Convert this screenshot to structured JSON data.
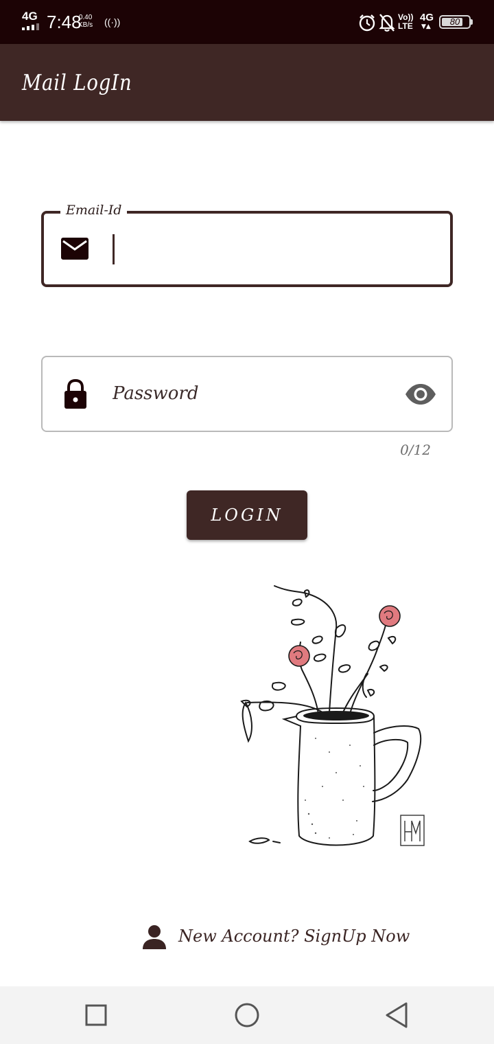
{
  "status_bar": {
    "network": "4G",
    "time": "7:48",
    "speed_value": "0.40",
    "speed_unit": "KB/s",
    "hotspot_icon": "hotspot-icon",
    "volte_line1": "Vo))",
    "volte_line2": "LTE",
    "network_type": "4G",
    "battery": "80",
    "battery_level": 0.8
  },
  "app_bar": {
    "title": "Mail LogIn"
  },
  "email_field": {
    "label": "Email-Id",
    "value": "",
    "icon": "mail-icon"
  },
  "password_field": {
    "placeholder": "Password",
    "value": "",
    "icon": "lock-icon",
    "toggle_icon": "eye-icon",
    "counter": "0/12"
  },
  "login_button": {
    "label": "LOGIN"
  },
  "illustration": {
    "monogram": "HM",
    "description_icon": "flower-vase-illustration"
  },
  "signup": {
    "icon": "person-icon",
    "label": "New Account?  SignUp Now"
  },
  "nav_bar": {
    "recents_icon": "square-icon",
    "home_icon": "circle-icon",
    "back_icon": "triangle-back-icon"
  },
  "colors": {
    "status_bar_bg": "#1c0305",
    "app_bar_bg": "#3f2725",
    "accent": "#3f2725",
    "nav_bar_bg": "#f3f3f3",
    "rose": "#e07a7f"
  }
}
